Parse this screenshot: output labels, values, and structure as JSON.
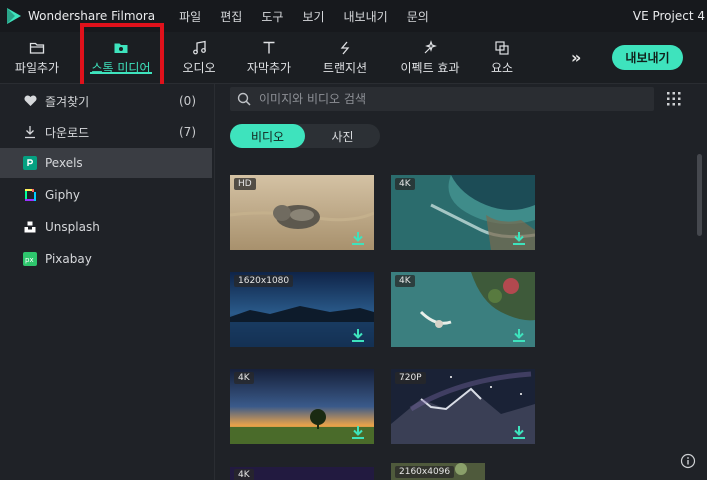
{
  "app": {
    "name": "Wondershare Filmora",
    "project": "VE Project 4"
  },
  "menu": [
    "파일",
    "편집",
    "도구",
    "보기",
    "내보내기",
    "문의"
  ],
  "toolbar": {
    "tabs": [
      {
        "label": "파일추가",
        "icon": "folder-icon"
      },
      {
        "label": "스톡 미디어",
        "icon": "stock-media-icon",
        "active": true
      },
      {
        "label": "오디오",
        "icon": "music-note-icon"
      },
      {
        "label": "자막추가",
        "icon": "text-icon"
      },
      {
        "label": "트랜지션",
        "icon": "transition-icon"
      },
      {
        "label": "이펙트 효과",
        "icon": "effects-icon"
      },
      {
        "label": "요소",
        "icon": "elements-icon"
      }
    ],
    "more_icon": "double-chevron-right-icon",
    "export_label": "내보내기"
  },
  "sidebar": {
    "items": [
      {
        "label": "즐겨찾기",
        "count": "(0)",
        "icon": "heart-icon"
      },
      {
        "label": "다운로드",
        "count": "(7)",
        "icon": "download-icon"
      },
      {
        "label": "Pexels",
        "count": "",
        "icon": "pexels-icon",
        "selected": true
      },
      {
        "label": "Giphy",
        "count": "",
        "icon": "giphy-icon"
      },
      {
        "label": "Unsplash",
        "count": "",
        "icon": "unsplash-icon"
      },
      {
        "label": "Pixabay",
        "count": "",
        "icon": "pixabay-icon"
      }
    ]
  },
  "search": {
    "placeholder": "이미지와 비디오 검색"
  },
  "segment": {
    "video": "비디오",
    "photo": "사진"
  },
  "media": [
    {
      "badge": "HD"
    },
    {
      "badge": "4K"
    },
    {
      "badge": "1620x1080"
    },
    {
      "badge": "4K"
    },
    {
      "badge": "4K"
    },
    {
      "badge": "720P"
    },
    {
      "badge": "4K"
    },
    {
      "badge": "2160x4096"
    }
  ],
  "colors": {
    "accent": "#3ee3bd",
    "highlight": "#e0111b",
    "background": "#1f2227"
  }
}
